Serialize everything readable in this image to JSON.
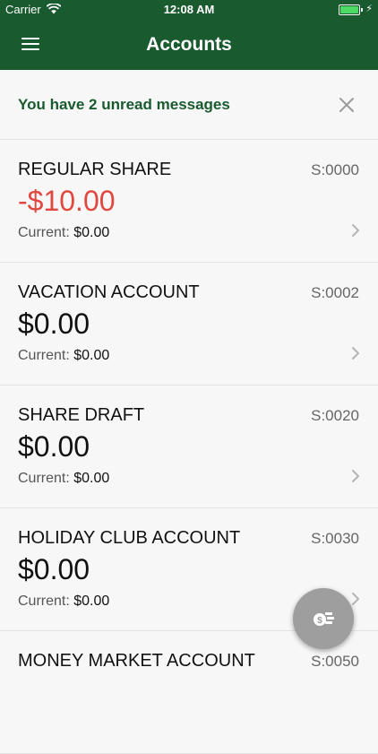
{
  "status_bar": {
    "carrier": "Carrier",
    "time": "12:08 AM"
  },
  "header": {
    "title": "Accounts",
    "menu_icon": "hamburger-menu-icon"
  },
  "banner": {
    "message": "You have 2 unread messages",
    "close_icon": "close-icon"
  },
  "accounts": [
    {
      "name": "REGULAR SHARE",
      "number": "S:0000",
      "balance": "-$10.00",
      "current_label": "Current:",
      "current_value": "$0.00"
    },
    {
      "name": "VACATION ACCOUNT",
      "number": "S:0002",
      "balance": "$0.00",
      "current_label": "Current:",
      "current_value": "$0.00"
    },
    {
      "name": "SHARE DRAFT",
      "number": "S:0020",
      "balance": "$0.00",
      "current_label": "Current:",
      "current_value": "$0.00"
    },
    {
      "name": "HOLIDAY CLUB ACCOUNT",
      "number": "S:0030",
      "balance": "$0.00",
      "current_label": "Current:",
      "current_value": "$0.00"
    },
    {
      "name": "MONEY MARKET ACCOUNT",
      "number": "S:0050",
      "balance": "",
      "current_label": "",
      "current_value": ""
    }
  ],
  "fab": {
    "icon": "money-transfer-icon"
  },
  "colors": {
    "header_bg": "#195a2f",
    "banner_text": "#195a2f",
    "negative_balance": "#e0473f",
    "fab_bg": "#9e9e9e"
  }
}
